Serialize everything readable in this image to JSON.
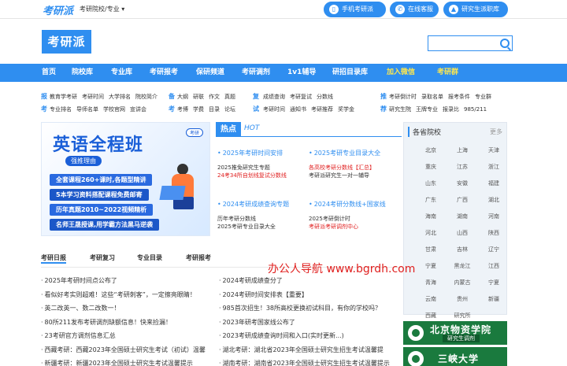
{
  "topbar": {
    "logo": "考研派",
    "school_dropdown": "考研院校/专业",
    "mobile_button": "手机考研派",
    "service_button": "在线客服",
    "library_button": "研究生派职库"
  },
  "header": {
    "logo": "考研派",
    "search_placeholder": ""
  },
  "nav": {
    "items": [
      "首页",
      "院校库",
      "专业库",
      "考研报考",
      "保研频道",
      "考研调剂",
      "1v1辅导",
      "研招目录库",
      "加入微信",
      "考研群"
    ]
  },
  "quick": {
    "groups": [
      {
        "label1": "报",
        "label2": "考",
        "row1": [
          "教育学考研",
          "考研时间",
          "大学排名",
          "院校简介"
        ],
        "row2": [
          "专业排名",
          "导师名单",
          "学校官网",
          "宣讲会"
        ]
      },
      {
        "label1": "备",
        "label2": "考",
        "row1": [
          "大纲",
          "研联",
          "作文",
          "真题"
        ],
        "row2": [
          "考博",
          "学费",
          "目录",
          "论坛"
        ]
      },
      {
        "label1": "复",
        "label2": "试",
        "row1": [
          "成绩查询",
          "考研复试",
          "分数线"
        ],
        "row2": [
          "考研时间",
          "通知书",
          "考研推荐"
        ]
      },
      {
        "label1": "推",
        "label2": "荐",
        "row1": [
          "考研倒计时",
          "录取名单",
          "报考条件",
          "专业群"
        ],
        "row2": [
          "研究生院",
          "王牌专业",
          "报录比",
          "985/211"
        ]
      }
    ],
    "extra_row2": [
      "奖学金"
    ]
  },
  "banner": {
    "title": "英语全程班",
    "tag": "强推理由",
    "badge": "考研",
    "lines": [
      "全套课程260+课时,各题型精讲",
      "5本学习资料搭配课程免费邮寄",
      "历年真题2010~2022视频精析",
      "名师王晟授课,用学霸方法黑马逆袭"
    ]
  },
  "hot": {
    "title": "热点",
    "subtitle": "HOT",
    "blocks": [
      {
        "head": "2025年考研时间安排",
        "lines": [
          {
            "t": "2025推免研究生专题",
            "red": false
          },
          {
            "t": "24考34所自划线复试分数线",
            "red": true
          }
        ]
      },
      {
        "head": "2025考研专业目录大全",
        "lines": [
          {
            "t": "各高校考研分数线【汇总】",
            "red": true
          },
          {
            "t": "考研派研究生一对一辅导",
            "red": false
          }
        ]
      },
      {
        "head": "2024考研成绩查询专题",
        "lines": [
          {
            "t": "历年考研分数线",
            "red": false
          },
          {
            "t": "2025考研专业目录大全",
            "red": false
          }
        ]
      },
      {
        "head": "2024考研分数线+国家线",
        "lines": [
          {
            "t": "2025考研倒计时",
            "red": false
          },
          {
            "t": "考研派考研调剂中心",
            "red": true
          }
        ]
      }
    ]
  },
  "side": {
    "title": "各省院校",
    "more": "更多",
    "regions": [
      "北京",
      "上海",
      "天津",
      "重庆",
      "江苏",
      "浙江",
      "山东",
      "安徽",
      "福建",
      "广东",
      "广西",
      "湖北",
      "海南",
      "湖南",
      "河南",
      "河北",
      "山西",
      "陕西",
      "甘肃",
      "吉林",
      "辽宁",
      "宁夏",
      "黑龙江",
      "江西",
      "青海",
      "内蒙古",
      "宁夏",
      "云南",
      "贵州",
      "新疆",
      "西藏",
      "研究所"
    ]
  },
  "tabs": [
    "考研日报",
    "考研复习",
    "专业目录",
    "考研报考"
  ],
  "watermark": "办公人导航  www.bgrdh.com",
  "news_left": [
    "2025年考研时间点公布了",
    "看似好考实则超难！这些“考研刺客”，一定擦亮眼睛！",
    "英二改英一、数二改数一！",
    "80所211发布考研调剂缺额信息！快来捡漏！",
    "23考研官方调剂信息汇总",
    "西藏考研：西藏2023年全国硕士研究生考试（初试）温馨",
    "新疆考研：新疆2023年全国硕士研究生考试温馨提示"
  ],
  "news_right": [
    "2024考研成绩查分了",
    "2024考研时间安排表【重要】",
    "985首次招生！38所高校更换初试科目，有你的学校吗？",
    "2023年研考国家线公布了",
    "2023考研成绩查询时间和入口(实时更新...)",
    "湖北考研：湖北省2023年全国硕士研究生招生考试温馨提",
    "湖南考研：湖南省2023年全国硕士研究生招生考试温馨提示"
  ],
  "univ": [
    {
      "name": "北京物资学院",
      "sub": "研究生调剂"
    },
    {
      "name": "三峡大学",
      "sub": ""
    }
  ]
}
